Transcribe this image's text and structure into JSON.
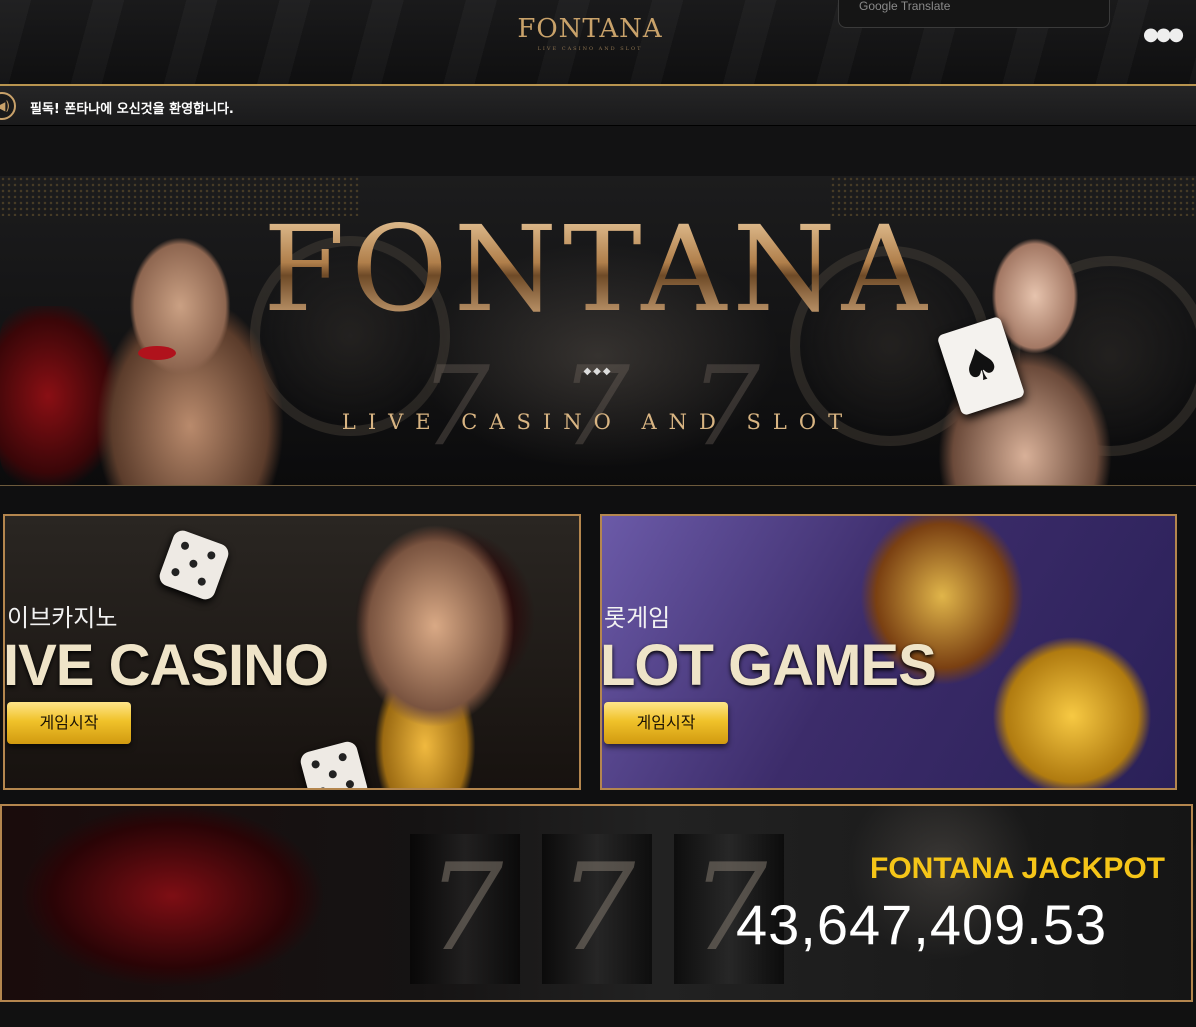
{
  "header": {
    "logo_text": "FONTANA",
    "logo_sub": "LIVE CASINO AND SLOT",
    "translate_label": "Google Translate",
    "more_icon": "ellipsis-icon"
  },
  "notice": {
    "icon": "speaker-icon",
    "text": "필독! 폰타나에 오신것을 환영합니다."
  },
  "hero": {
    "title": "FONTANA",
    "subtitle": "LIVE CASINO AND SLOT",
    "ornament": "◆◆◆"
  },
  "games": [
    {
      "title_ko": "이브카지노",
      "title_en": "IVE CASINO",
      "button": "게임시작"
    },
    {
      "title_ko": "롯게임",
      "title_en": "LOT GAMES",
      "button": "게임시작"
    }
  ],
  "jackpot": {
    "title": "FONTANA JACKPOT",
    "value": "43,647,409.53"
  },
  "colors": {
    "gold": "#c9a26a",
    "jackpot_yellow": "#f5c518",
    "button_gold": "#f0c22a"
  }
}
